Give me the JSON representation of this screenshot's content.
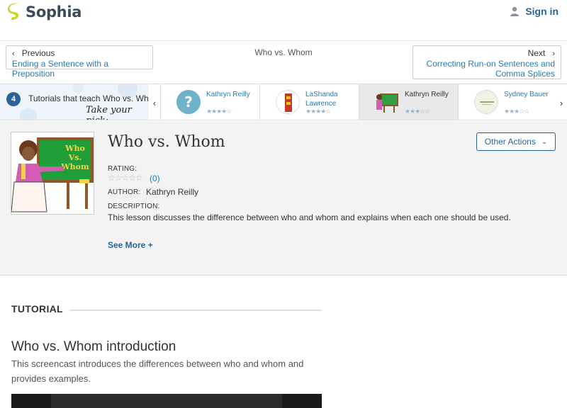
{
  "header": {
    "logo_text": "Sophia",
    "signin_label": "Sign in",
    "brand_color": "#c6d72f"
  },
  "nav": {
    "prev_label": "Previous",
    "prev_link": "Ending a Sentence with a Preposition",
    "current": "Who vs. Whom",
    "next_label": "Next",
    "next_link_line1": "Correcting Run-on Sentences and",
    "next_link_line2": "Comma Splices"
  },
  "strip": {
    "count": "4",
    "text": "Tutorials that teach Who vs. Wh",
    "pick": "Take your pick:",
    "cards": [
      {
        "name": "Kathryn Reilly",
        "stars": "★★★★☆"
      },
      {
        "name": "LaShanda Lawrence",
        "stars": "★★★★☆"
      },
      {
        "name": "Kathryn Reilly",
        "stars": "★★★☆☆"
      },
      {
        "name": "Sydney Bauer",
        "stars": "★★★☆☆"
      }
    ]
  },
  "lesson": {
    "title": "Who vs. Whom",
    "other_actions": "Other Actions",
    "rating_label": "RATING:",
    "rating_stars": "☆☆☆☆☆",
    "rating_count": "(0)",
    "author_label": "AUTHOR:",
    "author": "Kathryn Reilly",
    "description_label": "DESCRIPTION:",
    "description": "This lesson discusses the difference between who and whom and explains when each one should be used.",
    "see_more": "See More +",
    "board_line1": "Who",
    "board_line2": "Vs.",
    "board_line3": "Whom"
  },
  "tutorial": {
    "heading": "TUTORIAL",
    "title": "Who vs. Whom introduction",
    "description": "This screencast introduces the differences between who and whom and provides examples."
  }
}
